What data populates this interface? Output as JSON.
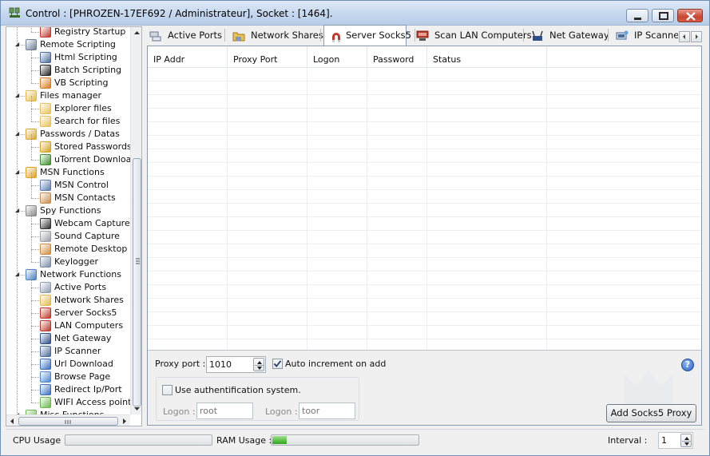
{
  "window": {
    "title": "Control : [PHROZEN-17EF692 / Administrateur], Socket : [1464]."
  },
  "tree": {
    "nodes": [
      {
        "label": "Registry Startup",
        "icon": "toolbox-icon",
        "level": 2,
        "color": "#c0392b"
      },
      {
        "label": "Remote Scripting",
        "icon": "script-icon",
        "level": 1,
        "color": "#6d7f95",
        "expanded": true
      },
      {
        "label": "Html Scripting",
        "icon": "html-script-icon",
        "level": 2,
        "color": "#4a6a9a"
      },
      {
        "label": "Batch Scripting",
        "icon": "batch-icon",
        "level": 2,
        "color": "#222222"
      },
      {
        "label": "VB Scripting",
        "icon": "vb-script-icon",
        "level": 2,
        "color": "#d97b1f"
      },
      {
        "label": "Files manager",
        "icon": "folders-icon",
        "level": 1,
        "color": "#e2b94a",
        "expanded": true
      },
      {
        "label": "Explorer files",
        "icon": "explorer-icon",
        "level": 2,
        "color": "#e8c055"
      },
      {
        "label": "Search for files",
        "icon": "search-folder-icon",
        "level": 2,
        "color": "#e8c055"
      },
      {
        "label": "Passwords / Datas",
        "icon": "keys-icon",
        "level": 1,
        "color": "#d9a637",
        "expanded": true
      },
      {
        "label": "Stored Passwords",
        "icon": "lock-icon",
        "level": 2,
        "color": "#d6a020"
      },
      {
        "label": "uTorrent Downloads",
        "icon": "utorrent-icon",
        "level": 2,
        "color": "#3a8f2a"
      },
      {
        "label": "MSN Functions",
        "icon": "msn-icon",
        "level": 1,
        "color": "#e0a020",
        "expanded": true
      },
      {
        "label": "MSN Control",
        "icon": "msn-control-icon",
        "level": 2,
        "color": "#5b7bb0"
      },
      {
        "label": "MSN Contacts",
        "icon": "contacts-icon",
        "level": 2,
        "color": "#c98a4a"
      },
      {
        "label": "Spy Functions",
        "icon": "spiral-icon",
        "level": 1,
        "color": "#8a8a8a",
        "expanded": true
      },
      {
        "label": "Webcam Capture",
        "icon": "webcam-icon",
        "level": 2,
        "color": "#333333"
      },
      {
        "label": "Sound Capture",
        "icon": "microphone-icon",
        "level": 2,
        "color": "#9aa0a6"
      },
      {
        "label": "Remote Desktop",
        "icon": "desktop-icon",
        "level": 2,
        "color": "#d38a3a"
      },
      {
        "label": "Keylogger",
        "icon": "keylogger-icon",
        "level": 2,
        "color": "#7a8ca6"
      },
      {
        "label": "Network Functions",
        "icon": "network-icon",
        "level": 1,
        "color": "#4a7fc1",
        "expanded": true
      },
      {
        "label": "Active Ports",
        "icon": "ports-icon",
        "level": 2,
        "color": "#8f9bb0"
      },
      {
        "label": "Network Shares",
        "icon": "shares-icon",
        "level": 2,
        "color": "#e2b94a"
      },
      {
        "label": "Server Socks5",
        "icon": "magnet-icon",
        "level": 2,
        "color": "#c0392b"
      },
      {
        "label": "LAN Computers",
        "icon": "lan-icon",
        "level": 2,
        "color": "#b83a2a"
      },
      {
        "label": "Net Gateway",
        "icon": "gateway-icon",
        "level": 2,
        "color": "#2d4f8a"
      },
      {
        "label": "IP Scanner",
        "icon": "scanner-icon",
        "level": 2,
        "color": "#4a6a9a"
      },
      {
        "label": "Url Download",
        "icon": "download-icon",
        "level": 2,
        "color": "#3a6fc0"
      },
      {
        "label": "Browse Page",
        "icon": "browse-icon",
        "level": 2,
        "color": "#4a86d0"
      },
      {
        "label": "Redirect Ip/Port",
        "icon": "redirect-icon",
        "level": 2,
        "color": "#3a6fc0"
      },
      {
        "label": "WIFI Access points",
        "icon": "wifi-icon",
        "level": 2,
        "color": "#6bb94a"
      },
      {
        "label": "Misc Functions",
        "icon": "misc-icon",
        "level": 1,
        "color": "#6bb94a"
      }
    ]
  },
  "tabs": [
    {
      "label": "Active Ports",
      "icon": "ports-icon",
      "color": "#8f9bb0",
      "active": false
    },
    {
      "label": "Network Shares",
      "icon": "shares-icon",
      "color": "#e2b94a",
      "active": false
    },
    {
      "label": "Server Socks5",
      "icon": "magnet-icon",
      "color": "#c0392b",
      "active": true
    },
    {
      "label": "Scan LAN Computers",
      "icon": "lan-icon",
      "color": "#b83a2a",
      "active": false
    },
    {
      "label": "Net Gateway",
      "icon": "gateway-icon",
      "color": "#2d4f8a",
      "active": false
    },
    {
      "label": "IP Scanner",
      "icon": "scanner-icon",
      "color": "#4a6a9a",
      "active": false
    }
  ],
  "grid": {
    "columns": [
      "IP Addr",
      "Proxy Port",
      "Logon",
      "Password",
      "Status"
    ],
    "rows": []
  },
  "socks5": {
    "proxy_port_label": "Proxy port :",
    "proxy_port_value": "1010",
    "auto_increment_label": "Auto increment on add",
    "auto_increment_checked": true,
    "use_auth_label": "Use authentification system.",
    "use_auth_checked": false,
    "logon_label_1": "Logon :",
    "logon_value": "root",
    "logon_label_2": "Logon :",
    "password_value": "toor",
    "add_button": "Add Socks5 Proxy",
    "help_icon": "?"
  },
  "statusbar": {
    "cpu_label": "CPU Usage :",
    "cpu_usage": 0.0,
    "ram_label": "RAM Usage :",
    "ram_usage": 0.1,
    "interval_label": "Interval :",
    "interval_value": "1"
  },
  "colors": {
    "accent": "#3a6fc0",
    "progress_green": "#2fa51b"
  }
}
